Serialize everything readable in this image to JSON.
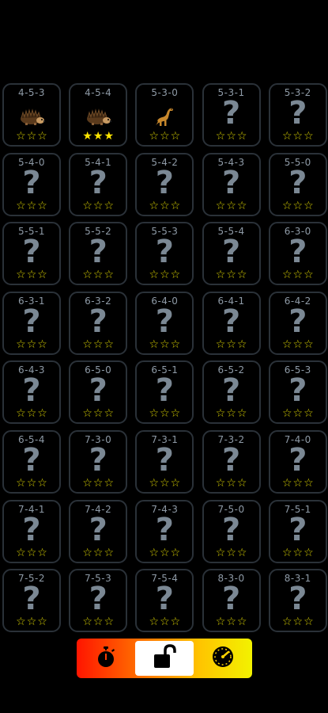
{
  "levels": [
    {
      "label": "4-5-3",
      "art": "hedgehog",
      "stars": [
        0,
        0,
        0
      ]
    },
    {
      "label": "4-5-4",
      "art": "hedgehog",
      "stars": [
        1,
        1,
        1
      ]
    },
    {
      "label": "5-3-0",
      "art": "dinosaur",
      "stars": [
        0,
        0,
        0
      ]
    },
    {
      "label": "5-3-1",
      "art": "unknown",
      "stars": [
        0,
        0,
        0
      ]
    },
    {
      "label": "5-3-2",
      "art": "unknown",
      "stars": [
        0,
        0,
        0
      ]
    },
    {
      "label": "5-4-0",
      "art": "unknown",
      "stars": [
        0,
        0,
        0
      ]
    },
    {
      "label": "5-4-1",
      "art": "unknown",
      "stars": [
        0,
        0,
        0
      ]
    },
    {
      "label": "5-4-2",
      "art": "unknown",
      "stars": [
        0,
        0,
        0
      ]
    },
    {
      "label": "5-4-3",
      "art": "unknown",
      "stars": [
        0,
        0,
        0
      ]
    },
    {
      "label": "5-5-0",
      "art": "unknown",
      "stars": [
        0,
        0,
        0
      ]
    },
    {
      "label": "5-5-1",
      "art": "unknown",
      "stars": [
        0,
        0,
        0
      ]
    },
    {
      "label": "5-5-2",
      "art": "unknown",
      "stars": [
        0,
        0,
        0
      ]
    },
    {
      "label": "5-5-3",
      "art": "unknown",
      "stars": [
        0,
        0,
        0
      ]
    },
    {
      "label": "5-5-4",
      "art": "unknown",
      "stars": [
        0,
        0,
        0
      ]
    },
    {
      "label": "6-3-0",
      "art": "unknown",
      "stars": [
        0,
        0,
        0
      ]
    },
    {
      "label": "6-3-1",
      "art": "unknown",
      "stars": [
        0,
        0,
        0
      ]
    },
    {
      "label": "6-3-2",
      "art": "unknown",
      "stars": [
        0,
        0,
        0
      ]
    },
    {
      "label": "6-4-0",
      "art": "unknown",
      "stars": [
        0,
        0,
        0
      ]
    },
    {
      "label": "6-4-1",
      "art": "unknown",
      "stars": [
        0,
        0,
        0
      ]
    },
    {
      "label": "6-4-2",
      "art": "unknown",
      "stars": [
        0,
        0,
        0
      ]
    },
    {
      "label": "6-4-3",
      "art": "unknown",
      "stars": [
        0,
        0,
        0
      ]
    },
    {
      "label": "6-5-0",
      "art": "unknown",
      "stars": [
        0,
        0,
        0
      ]
    },
    {
      "label": "6-5-1",
      "art": "unknown",
      "stars": [
        0,
        0,
        0
      ]
    },
    {
      "label": "6-5-2",
      "art": "unknown",
      "stars": [
        0,
        0,
        0
      ]
    },
    {
      "label": "6-5-3",
      "art": "unknown",
      "stars": [
        0,
        0,
        0
      ]
    },
    {
      "label": "6-5-4",
      "art": "unknown",
      "stars": [
        0,
        0,
        0
      ]
    },
    {
      "label": "7-3-0",
      "art": "unknown",
      "stars": [
        0,
        0,
        0
      ]
    },
    {
      "label": "7-3-1",
      "art": "unknown",
      "stars": [
        0,
        0,
        0
      ]
    },
    {
      "label": "7-3-2",
      "art": "unknown",
      "stars": [
        0,
        0,
        0
      ]
    },
    {
      "label": "7-4-0",
      "art": "unknown",
      "stars": [
        0,
        0,
        0
      ]
    },
    {
      "label": "7-4-1",
      "art": "unknown",
      "stars": [
        0,
        0,
        0
      ]
    },
    {
      "label": "7-4-2",
      "art": "unknown",
      "stars": [
        0,
        0,
        0
      ]
    },
    {
      "label": "7-4-3",
      "art": "unknown",
      "stars": [
        0,
        0,
        0
      ]
    },
    {
      "label": "7-5-0",
      "art": "unknown",
      "stars": [
        0,
        0,
        0
      ]
    },
    {
      "label": "7-5-1",
      "art": "unknown",
      "stars": [
        0,
        0,
        0
      ]
    },
    {
      "label": "7-5-2",
      "art": "unknown",
      "stars": [
        0,
        0,
        0
      ]
    },
    {
      "label": "7-5-3",
      "art": "unknown",
      "stars": [
        0,
        0,
        0
      ]
    },
    {
      "label": "7-5-4",
      "art": "unknown",
      "stars": [
        0,
        0,
        0
      ]
    },
    {
      "label": "8-3-0",
      "art": "unknown",
      "stars": [
        0,
        0,
        0
      ]
    },
    {
      "label": "8-3-1",
      "art": "unknown",
      "stars": [
        0,
        0,
        0
      ]
    }
  ],
  "unknown_glyph": "?",
  "star_glyph_off": "☆",
  "star_glyph_on": "★",
  "bottom_bar": {
    "buttons": [
      {
        "icon": "stopwatch-icon",
        "selected": false
      },
      {
        "icon": "unlocked-padlock-icon",
        "selected": true
      },
      {
        "icon": "speedometer-icon",
        "selected": false
      }
    ]
  },
  "colors": {
    "background": "#000000",
    "cell_border": "#2a3138",
    "label_text": "#8e9aa6",
    "question_mark": "#7b8894",
    "star": "#ffe600",
    "bar_gradient_start": "#ff1500",
    "bar_gradient_end": "#f2f200"
  }
}
